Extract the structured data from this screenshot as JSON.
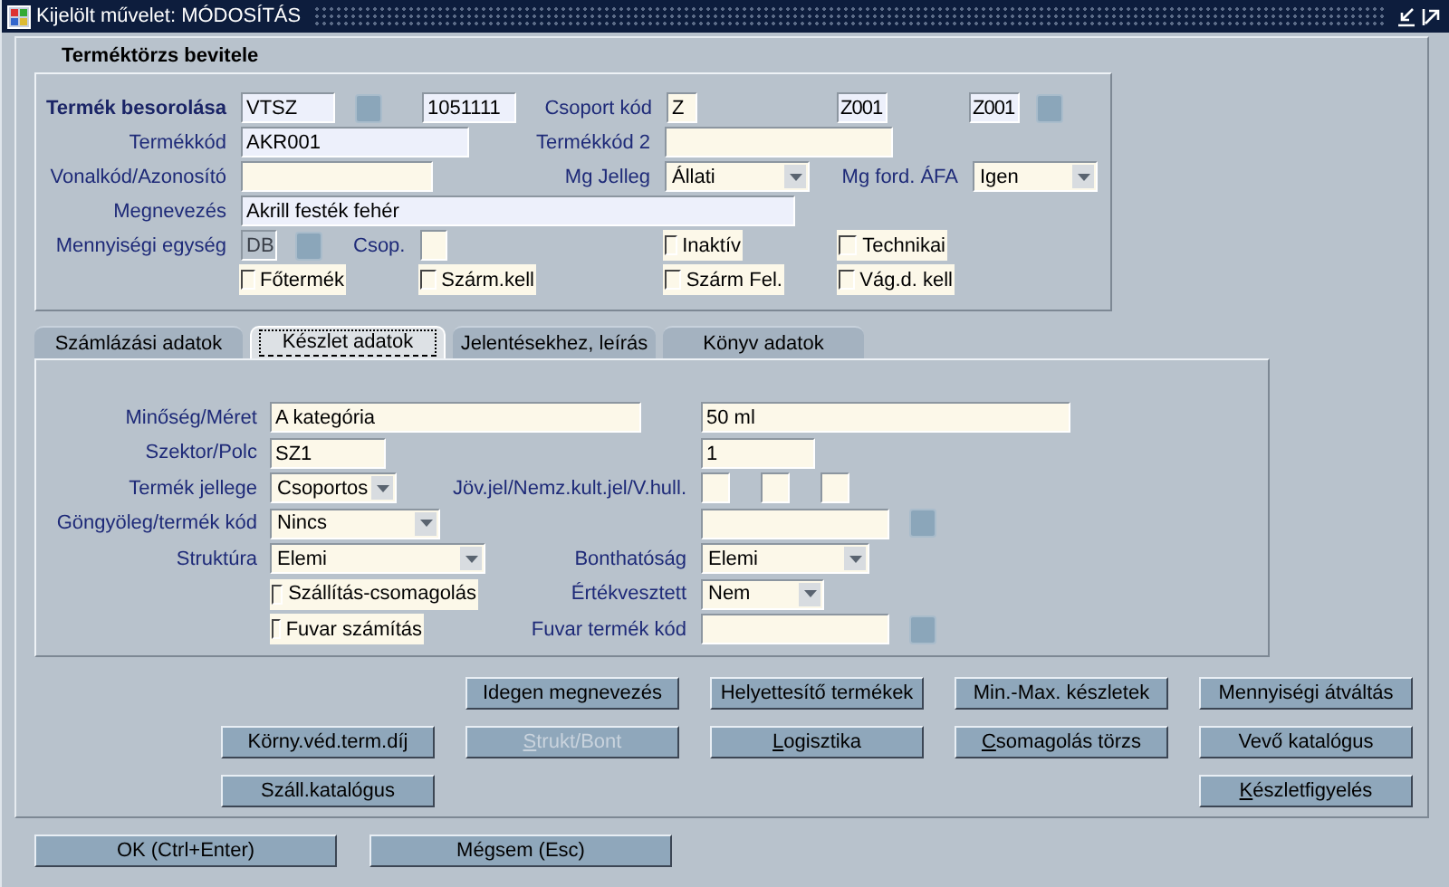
{
  "window": {
    "title": "Kijelölt művelet: MÓDOSÍTÁS"
  },
  "form_title": "Terméktörzs bevitele",
  "header": {
    "besorolas": {
      "label": "Termék besorolása",
      "value": "VTSZ",
      "code": "1051111"
    },
    "csoport": {
      "label": "Csoport kód",
      "value": "Z",
      "code_1": "Z001",
      "code_2": "Z001"
    },
    "termekkod": {
      "label": "Termékkód",
      "value": "AKR001"
    },
    "termekkod_2": {
      "label": "Termékkód 2"
    },
    "vonalkod": {
      "label": "Vonalkód/Azonosító"
    },
    "mg_jelleg": {
      "label": "Mg Jelleg",
      "value": "Állati"
    },
    "mg_ford_afa": {
      "label": "Mg ford. ÁFA",
      "value": "Igen"
    },
    "megnevezes": {
      "label": "Megnevezés",
      "value": "Akrill festék fehér"
    },
    "mennyisegi_egyseg": {
      "label": "Mennyiségi egység",
      "value": "DB"
    },
    "csop": {
      "label": "Csop."
    },
    "checkboxes": [
      {
        "label": "Inaktív",
        "checked": false
      },
      {
        "label": "Technikai",
        "checked": false
      },
      {
        "label": "Főtermék",
        "checked": false
      },
      {
        "label": "Szárm.kell",
        "checked": false
      },
      {
        "label": "Szárm Fel.",
        "checked": false
      },
      {
        "label": "Vág.d. kell",
        "checked": false
      }
    ]
  },
  "tabs": [
    {
      "label": "Számlázási adatok",
      "selected": false
    },
    {
      "label": "Készlet adatok",
      "selected": true
    },
    {
      "label": "Jelentésekhez, leírás",
      "selected": false
    },
    {
      "label": "Könyv adatok",
      "selected": false
    }
  ],
  "stock": {
    "minoseg": {
      "label": "Minőség/Méret",
      "value": "A kategória",
      "value_2": "50 ml"
    },
    "szektor": {
      "label": "Szektor/Polc",
      "value": "SZ1",
      "value_2": "1"
    },
    "termek_jellege": {
      "label": "Termék jellege",
      "value": "Csoportos"
    },
    "jov_jel": {
      "label": "Jöv.jel/Nemz.kult.jel/V.hull."
    },
    "gongyoleg": {
      "label": "Göngyöleg/termék kód",
      "value": "Nincs"
    },
    "struktura": {
      "label": "Struktúra",
      "value": "Elemi"
    },
    "bonthatosag": {
      "label": "Bonthatóság",
      "value": "Elemi"
    },
    "szallitas": {
      "label": "Szállítás-csomagolás",
      "checked": false
    },
    "ertekvesztett": {
      "label": "Értékvesztett",
      "value": "Nem"
    },
    "fuvar_szamitas": {
      "label": "Fuvar számítás",
      "checked": false
    },
    "fuvar_termek_kod": {
      "label": "Fuvar termék kód"
    }
  },
  "buttons": [
    [
      {
        "label": "Idegen megnevezés",
        "disabled": false,
        "mnemonic": false
      },
      {
        "label": "Helyettesítő termékek",
        "disabled": false,
        "mnemonic": false
      },
      {
        "label": "Min.-Max. készletek",
        "disabled": false,
        "mnemonic": false
      },
      {
        "label": "Mennyiségi átváltás",
        "disabled": false,
        "mnemonic": false
      }
    ],
    [
      {
        "label": "Körny.véd.term.díj",
        "disabled": false,
        "mnemonic": false
      },
      {
        "label": "Strukt/Bont",
        "disabled": true,
        "mnemonic": true
      },
      {
        "label": "Logisztika",
        "disabled": false,
        "mnemonic": true
      },
      {
        "label": "Csomagolás törzs",
        "disabled": false,
        "mnemonic": true
      },
      {
        "label": "Vevő katalógus",
        "disabled": false,
        "mnemonic": false
      }
    ],
    [
      {
        "label": "Száll.katalógus",
        "disabled": false,
        "mnemonic": false
      },
      {
        "label": "Készletfigyelés",
        "disabled": false,
        "mnemonic": true
      }
    ]
  ],
  "footer_buttons": [
    "OK (Ctrl+Enter)",
    "Mégsem (Esc)"
  ]
}
